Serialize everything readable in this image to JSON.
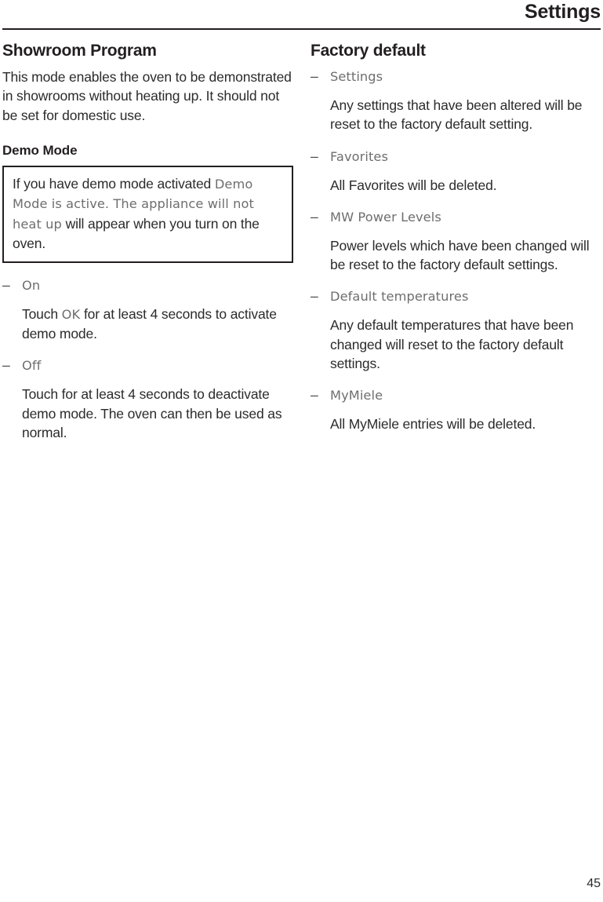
{
  "header": {
    "title": "Settings"
  },
  "left_column": {
    "section_heading": "Showroom Program",
    "intro_paragraph": "This mode enables the oven to be demonstrated in showrooms without heating up. It should not be set for domestic use.",
    "sub_heading": "Demo Mode",
    "note_box": {
      "part1": "If you have demo mode activated ",
      "display_message": "Demo Mode is active. The appliance will not heat up",
      "part2": " will appear when you turn on the oven."
    },
    "items": [
      {
        "marker": "–",
        "term": "On",
        "desc_before": "Touch ",
        "desc_display": "OK",
        "desc_after": " for at least 4 seconds to activate demo mode."
      },
      {
        "marker": "–",
        "term": "Off",
        "desc_before": "Touch for at least 4 seconds to deactivate demo mode. The oven can then be used as normal.",
        "desc_display": "",
        "desc_after": ""
      }
    ]
  },
  "right_column": {
    "section_heading": "Factory default",
    "items": [
      {
        "marker": "–",
        "term": "Settings",
        "desc": "Any settings that have been altered will be reset to the factory default setting."
      },
      {
        "marker": "–",
        "term": "Favorites",
        "desc": "All Favorites will be deleted."
      },
      {
        "marker": "–",
        "term": "MW Power Levels",
        "desc": "Power levels which have been changed will be reset to the factory default settings."
      },
      {
        "marker": "–",
        "term": "Default temperatures",
        "desc": "Any default temperatures that have been changed will reset to the factory default settings."
      },
      {
        "marker": "–",
        "term": "MyMiele",
        "desc": "All MyMiele entries will be deleted."
      }
    ]
  },
  "footer": {
    "page_number": "45"
  }
}
